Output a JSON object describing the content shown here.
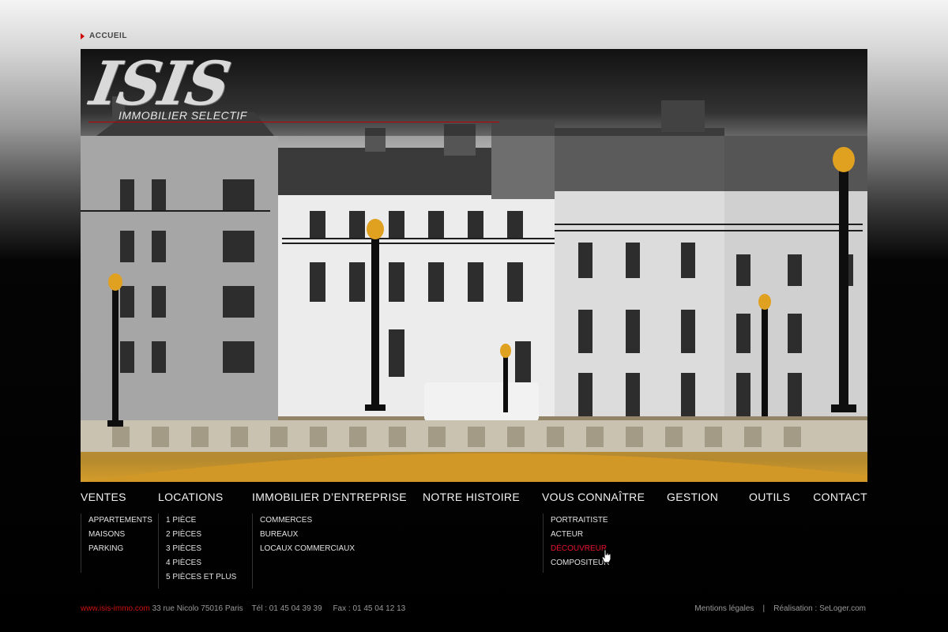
{
  "breadcrumb": {
    "label": "ACCUEIL"
  },
  "logo": {
    "main": "ISIS",
    "sub": "IMMOBILIER SELECTIF"
  },
  "nav": {
    "ventes": "VENTES",
    "locations": "LOCATIONS",
    "immobilier": "IMMOBILIER D’ENTREPRISE",
    "histoire": "NOTRE HISTOIRE",
    "connaitre": "VOUS CONNAÎTRE",
    "gestion": "GESTION",
    "outils": "OUTILS",
    "contact": "CONTACT"
  },
  "submenus": {
    "ventes": [
      "APPARTEMENTS",
      "MAISONS",
      "PARKING"
    ],
    "locations": [
      "1 PIÈCE",
      "2 PIÈCES",
      "3 PIÈCES",
      "4 PIÈCES",
      "5 PIÈCES ET PLUS"
    ],
    "immobilier": [
      "COMMERCES",
      "BUREAUX",
      "LOCAUX COMMERCIAUX"
    ],
    "connaitre": [
      "PORTRAITISTE",
      "ACTEUR",
      "DÉCOUVREUR",
      "COMPOSITEUR"
    ]
  },
  "footer": {
    "website": "www.isis-immo.com",
    "address": "33 rue Nicolo 75016 Paris",
    "tel": "Tél : 01 45 04 39 39",
    "fax": "Fax : 01 45 04 12 13",
    "legal": "Mentions légales",
    "separator": "|",
    "credit": "Réalisation : SeLoger.com"
  },
  "colors": {
    "accent": "#d00000",
    "active_menu": "#e8122e",
    "nav_text": "#f2f2f2",
    "lamp_glow": "#e0a020"
  },
  "icons": {
    "breadcrumb_arrow": "triangle-right",
    "cursor": "hand-pointer"
  }
}
